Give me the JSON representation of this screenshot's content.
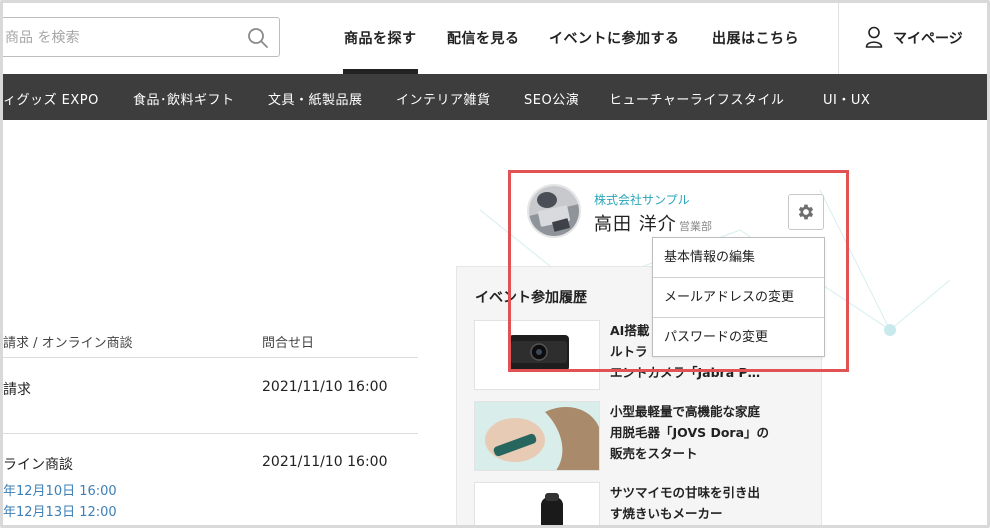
{
  "search": {
    "placeholder": "商品 を検索"
  },
  "nav": {
    "items": [
      "商品を探す",
      "配信を見る",
      "イベントに参加する",
      "出展はこちら"
    ],
    "active_index": 0,
    "mypage_label": "マイページ"
  },
  "categories": [
    "ィグッズ EXPO",
    "食品･飲料ギフト",
    "文具・紙製品展",
    "インテリア雑貨",
    "SEO公演",
    "ヒューチャーライフスタイル",
    "UI・UX"
  ],
  "table": {
    "headers": [
      "請求 / オンライン商談",
      "問合せ日"
    ],
    "rows": [
      {
        "type": "請求",
        "date": "2021/11/10 16:00",
        "slots": []
      },
      {
        "type": "ライン商談",
        "date": "2021/11/10 16:00",
        "slots": [
          "年12月10日 16:00",
          "年12月13日 12:00"
        ]
      }
    ]
  },
  "events": {
    "title": "イベント参加履歴",
    "items": [
      {
        "title": "AI搭載\nルトラ\nエントカメラ「Jabra P…"
      },
      {
        "title": "小型最軽量で高機能な家庭\n用脱毛器「JOVS Dora」の\n販売をスタート"
      },
      {
        "title": "サツマイモの甘味を引き出\nす焼きいもメーカー"
      }
    ]
  },
  "profile": {
    "company": "株式会社サンプル",
    "name": "高田 洋介",
    "department": "営業部"
  },
  "settings_menu": [
    "基本情報の編集",
    "メールアドレスの変更",
    "パスワードの変更"
  ],
  "colors": {
    "accent_teal": "#2ba6b8",
    "category_bar": "#3d3d3d",
    "highlight": "#e15254",
    "link_blue": "#3d7fb5"
  }
}
